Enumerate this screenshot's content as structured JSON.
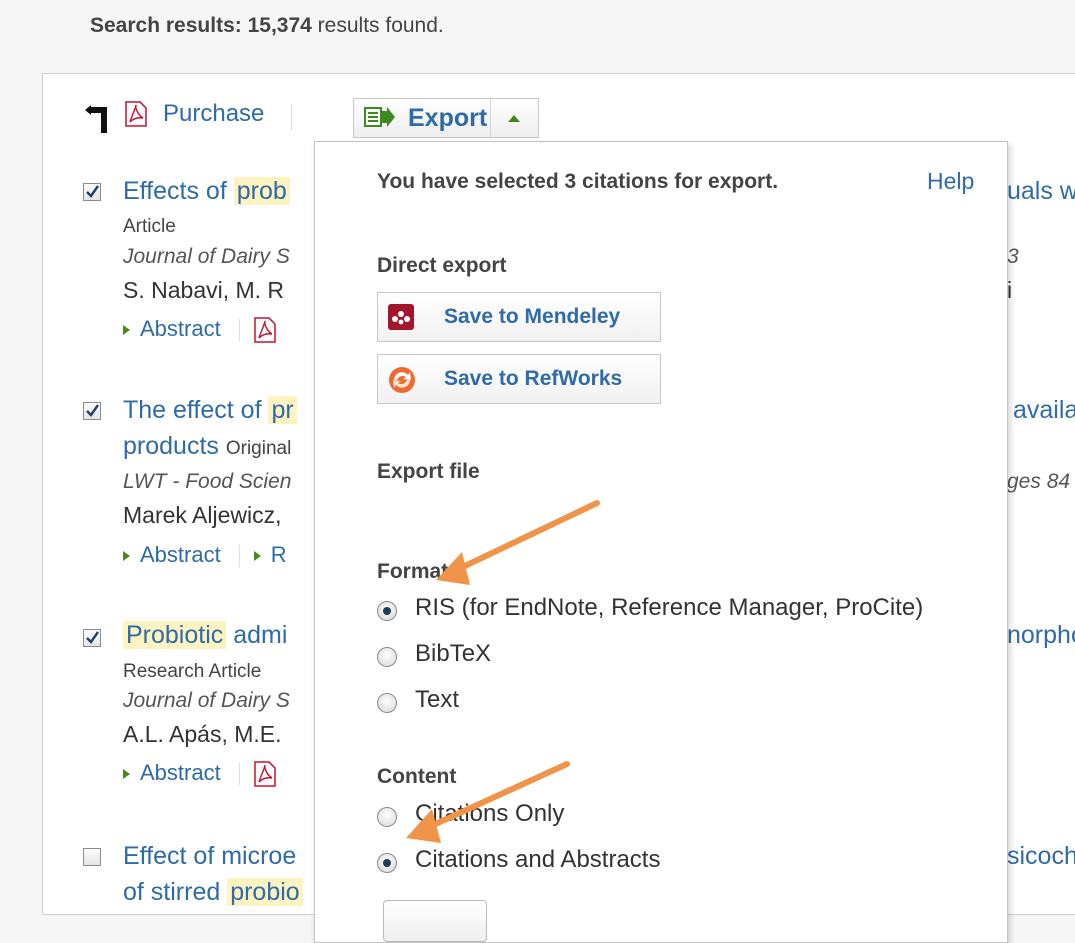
{
  "summary": {
    "label": "Search results:",
    "count": "15,374",
    "suffix": "results found."
  },
  "toolbar": {
    "purchase_label": "Purchase",
    "export_label": "Export"
  },
  "results": [
    {
      "title_pre": "Effects of ",
      "title_hl": "prob",
      "tail": "uals w",
      "type": "Article",
      "journal": "Journal of Dairy S",
      "journal_tail": "3",
      "authors": "S. Nabavi, M. R",
      "authors_tail": "i",
      "link_abstract": "Abstract"
    },
    {
      "title_pre": "The effect of ",
      "title_hl": "pr",
      "tail": "availa",
      "title2": "products",
      "type2": "Original",
      "journal": "LWT - Food Scien",
      "journal_tail": "ges 84",
      "authors": "Marek Aljewicz,",
      "link_abstract": "Abstract",
      "link_r": "R"
    },
    {
      "title_hl": "Probiotic",
      "title_post": " admi",
      "tail": "norpho",
      "type": "Research Article",
      "journal": "Journal of Dairy S",
      "authors": "A.L. Apás, M.E.",
      "link_abstract": "Abstract"
    },
    {
      "title_pre": "Effect of microe",
      "tail": "sicoch",
      "title2_pre": "of stirred ",
      "title2_hl": "probio"
    }
  ],
  "export_menu": {
    "heading": "You have selected 3 citations for export.",
    "help": "Help",
    "direct_export": "Direct export",
    "save_mendeley": "Save to Mendeley",
    "save_refworks": "Save to RefWorks",
    "export_file": "Export file",
    "format_label": "Format",
    "formats": [
      "RIS (for EndNote, Reference Manager, ProCite)",
      "BibTeX",
      "Text"
    ],
    "selected_format": "RIS (for EndNote, Reference Manager, ProCite)",
    "content_label": "Content",
    "contents": [
      "Citations Only",
      "Citations and Abstracts"
    ],
    "selected_content": "Citations and Abstracts"
  },
  "colors": {
    "link": "#2e6ba8",
    "highlight": "#fcf3c1",
    "annotation_arrow": "#f0944a",
    "mendeley": "#a3152a",
    "refworks": "#ee6a2f"
  },
  "icons": [
    "back-arrow-icon",
    "pdf-icon",
    "export-icon",
    "caret-up-icon",
    "checkbox-checked-icon",
    "mendeley-icon",
    "refworks-icon"
  ]
}
